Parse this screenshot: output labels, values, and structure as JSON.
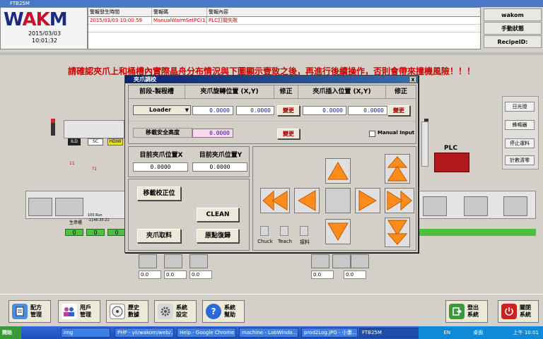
{
  "window": {
    "title": "FTB25M"
  },
  "logo": {
    "text_left": "W",
    "text_mid": "AK",
    "text_right": "M",
    "date": "2015/03/03",
    "time": "10:01:32"
  },
  "alarm": {
    "headers": [
      "警報發生時間",
      "警報碼",
      "警報內容"
    ],
    "rows": [
      {
        "time": "2015/03/03 10:00:59",
        "code": "ManualWarmSetPC(1)",
        "content": "PLC訂閱失敗"
      }
    ]
  },
  "rightinfo": {
    "user": "wakom",
    "mode": "手動狀態",
    "recipe_label": "RecipeID:"
  },
  "warning": "請確認夾爪上和桶槽內實際晶舟分布情況與下圖顯示壹致之後，再進行後續操作，否則會帶來撞機風險！！！",
  "side_buttons": [
    "日光燈",
    "蜂鳴器",
    "停止運料",
    "計數清零"
  ],
  "plc_label": "PLC",
  "equipment": {
    "tags": [
      "ILD",
      "SC",
      "HDIW"
    ],
    "flags": [
      "11",
      "?1"
    ],
    "wafer_label": "生串櫃",
    "run_info": [
      "100 Run",
      "-1146:35:21"
    ],
    "status_values": [
      "0",
      "0",
      "0"
    ],
    "small_boxes": [
      "0.0",
      "0.0",
      "0.0",
      "0.0",
      "0.0"
    ]
  },
  "dialog": {
    "title": "夾爪調校",
    "close": "x",
    "headers": [
      "前段-製程槽",
      "夾爪旋轉位置 (X,Y)",
      "修正",
      "夾爪插入位置 (X,Y)",
      "修正"
    ],
    "station": "Loader",
    "rotate_x": "0.0000",
    "rotate_y": "0.0000",
    "insert_x": "0.0000",
    "insert_y": "0.0000",
    "modify_label": "變更",
    "safe_height_label": "移載安全高度",
    "safe_height": "0.0000",
    "manual_input_label": "Manual Input",
    "cur_x_label": "目前夾爪位置X",
    "cur_y_label": "目前夾爪位置Y",
    "cur_x": "0.0000",
    "cur_y": "0.0000",
    "btn_calibrate": "移載校正位",
    "btn_clean": "CLEAN",
    "btn_pick": "夾爪取料",
    "btn_home": "原點復歸",
    "icon_labels": [
      "Chuck",
      "Teach",
      "接料"
    ]
  },
  "toolbar": [
    {
      "line1": "配方",
      "line2": "管理",
      "icon": "recipe-icon"
    },
    {
      "line1": "用戶",
      "line2": "管理",
      "icon": "users-icon"
    },
    {
      "line1": "歷史",
      "line2": "數據",
      "icon": "history-icon"
    },
    {
      "line1": "系統",
      "line2": "設定",
      "icon": "settings-icon"
    },
    {
      "line1": "系統",
      "line2": "幫助",
      "icon": "help-icon"
    },
    {
      "line1": "登出",
      "line2": "系統",
      "icon": "logout-icon"
    },
    {
      "line1": "關閉",
      "line2": "系統",
      "icon": "power-icon"
    }
  ],
  "taskbar": {
    "start": "開始",
    "tasks": [
      "img",
      "PHP - yii/wakom/web/...",
      "Help - Google Chrome",
      "machine - LabWindo...",
      "prod2Log.JPG - 小畫...",
      "FTB25M"
    ],
    "tray": "桌面",
    "lang": "EN",
    "clock": "上午 10:01"
  },
  "colors": {
    "warning": "#d00000",
    "title_bar": "#0a246a",
    "arrow": "#ff8c1a",
    "status_green": "#4ec040"
  }
}
